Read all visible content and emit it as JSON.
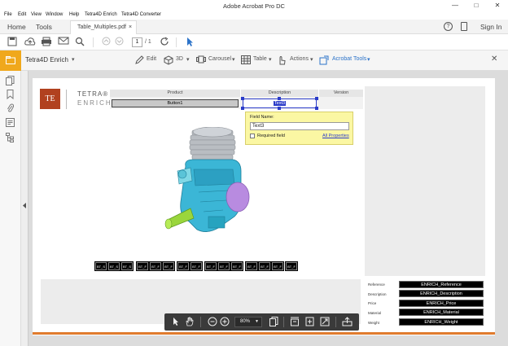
{
  "window": {
    "title": "Adobe Acrobat Pro DC",
    "min_glyph": "—",
    "max_glyph": "□",
    "close_glyph": "✕"
  },
  "menu": [
    "File",
    "Edit",
    "View",
    "Window",
    "Help",
    "Tetra4D Enrich",
    "Tetra4D Converter"
  ],
  "tabs": {
    "home": "Home",
    "tools": "Tools",
    "document": "Table_Multiples.pdf",
    "document_close": "×",
    "sign_in": "Sign In"
  },
  "toolbar": {
    "page_current": "1",
    "page_total": "/ 1"
  },
  "plugin_bar": {
    "name": "Tetra4D Enrich",
    "edit": "Edit",
    "three_d": "3D",
    "carousel": "Carousel",
    "table": "Table",
    "actions": "Actions",
    "acrobat_tools": "Acrobat Tools",
    "caret": "▾",
    "close": "✕"
  },
  "logo": {
    "mark": "TE",
    "line1": "TETRA®",
    "line2": "ENRICH"
  },
  "table": {
    "headers": [
      "Product",
      "Description",
      "Version"
    ],
    "button_field": "Button1",
    "text_field": "Text3"
  },
  "popup": {
    "field_name_label": "Field Name:",
    "field_name_value": "Text3",
    "required_label": "Required field",
    "all_properties": "All Properties"
  },
  "bt_buttons": [
    "BT_S",
    "BT_S",
    "BT_S",
    "BT_F",
    "BT_F",
    "BT_F",
    "BT_F",
    "BT_F",
    "BT_F",
    "BT_F",
    "BT_F",
    "BT_F",
    "BT_F",
    "BT_F",
    "BT_F",
    "BT_F",
    "BT_F"
  ],
  "enrich_fields": [
    {
      "label": "Reference",
      "value": "ENRICH_Reference"
    },
    {
      "label": "Description",
      "value": "ENRICH_Description"
    },
    {
      "label": "Price",
      "value": "ENRICH_Price"
    },
    {
      "label": "Material",
      "value": "ENRICH_Material"
    },
    {
      "label": "Weight",
      "value": "ENRICH_Weight"
    }
  ],
  "floatbar": {
    "zoom": "80%"
  },
  "colors": {
    "accent_orange": "#e07b2e",
    "logo_red": "#b1411f",
    "selection_blue": "#2b3cc9",
    "popup_yellow": "#fbf7a3"
  }
}
